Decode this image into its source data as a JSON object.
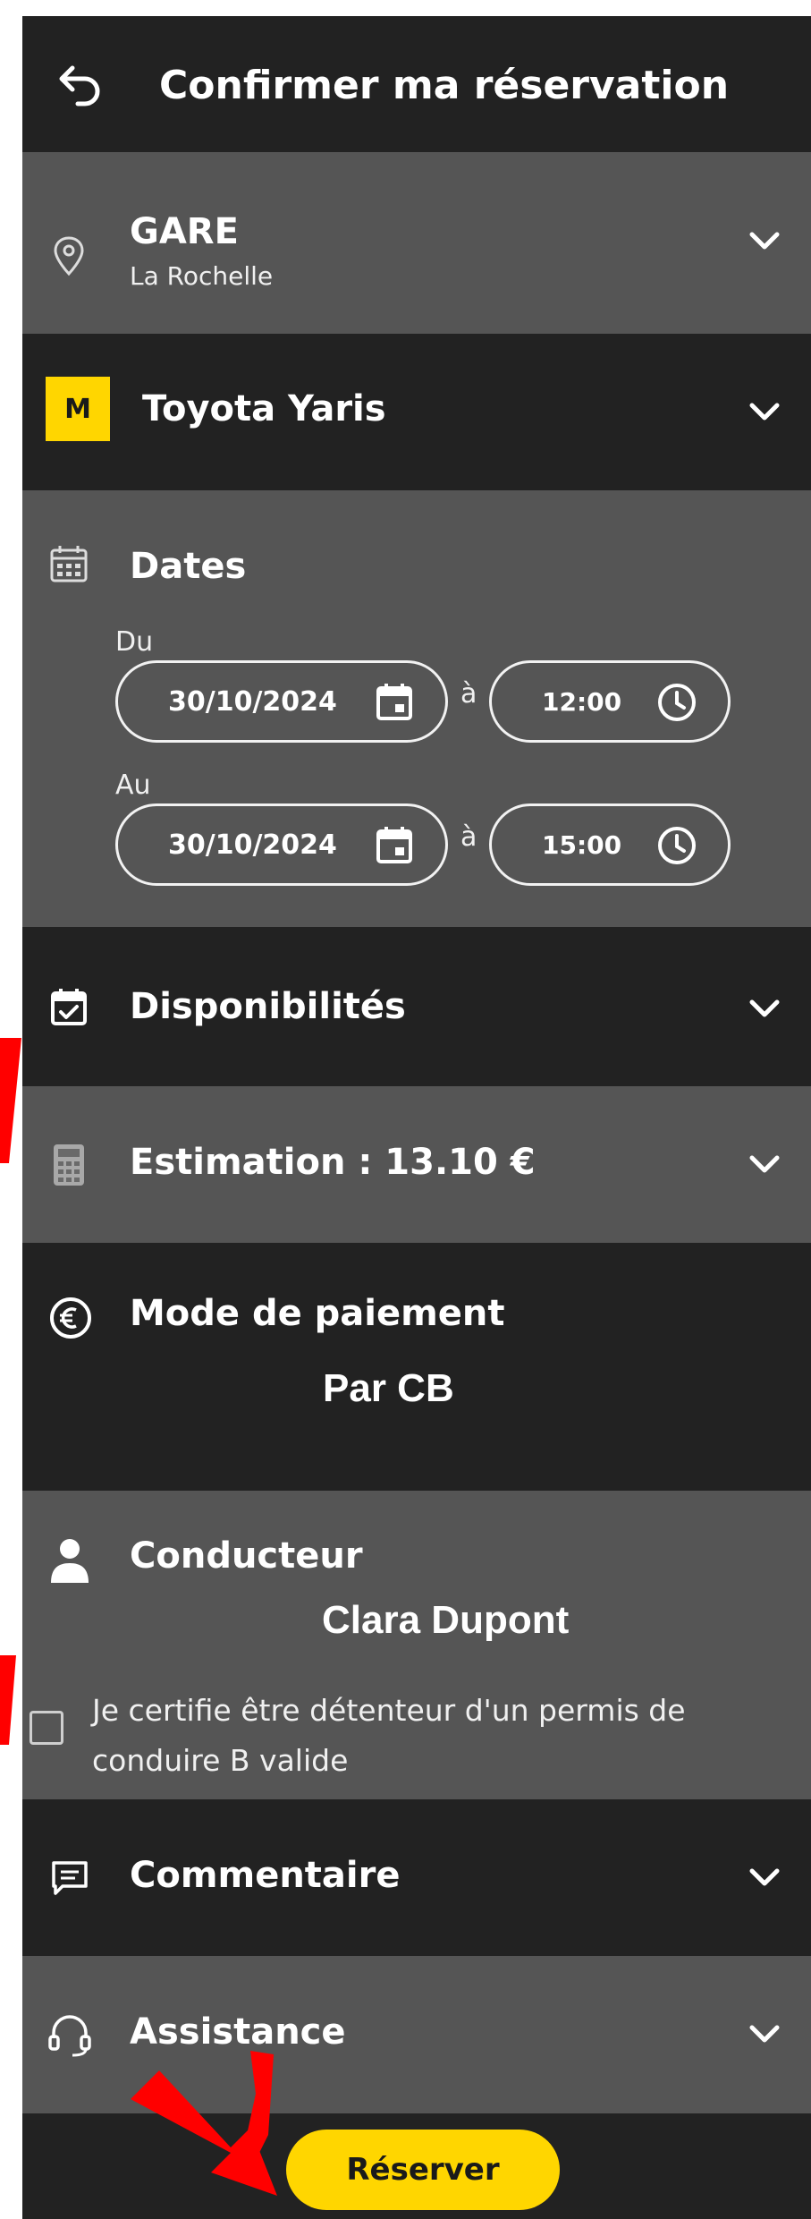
{
  "header": {
    "title": "Confirmer ma réservation"
  },
  "station": {
    "label": "GARE",
    "value": "La Rochelle"
  },
  "vehicle": {
    "badge": "M",
    "name": "Toyota Yaris"
  },
  "dates": {
    "title": "Dates",
    "from_label": "Du",
    "to_label": "Au",
    "from_date": "30/10/2024",
    "from_time": "12:00",
    "to_date": "30/10/2024",
    "to_time": "15:00",
    "separator": "à"
  },
  "availability": {
    "title": "Disponibilités"
  },
  "estimate": {
    "title": "Estimation : 13.10 €"
  },
  "payment": {
    "title": "Mode de paiement",
    "value": "Par CB"
  },
  "driver": {
    "title": "Conducteur",
    "name": "Clara Dupont",
    "certify_text": "Je certifie être détenteur d'un permis de conduire B valide",
    "checked": false
  },
  "comment": {
    "title": "Commentaire"
  },
  "assistance": {
    "title": "Assistance"
  },
  "actions": {
    "reserve_label": "Réserver"
  },
  "colors": {
    "accent": "#ffd600",
    "dark": "#222222",
    "grey": "#555555",
    "annotation": "#ff0000"
  }
}
